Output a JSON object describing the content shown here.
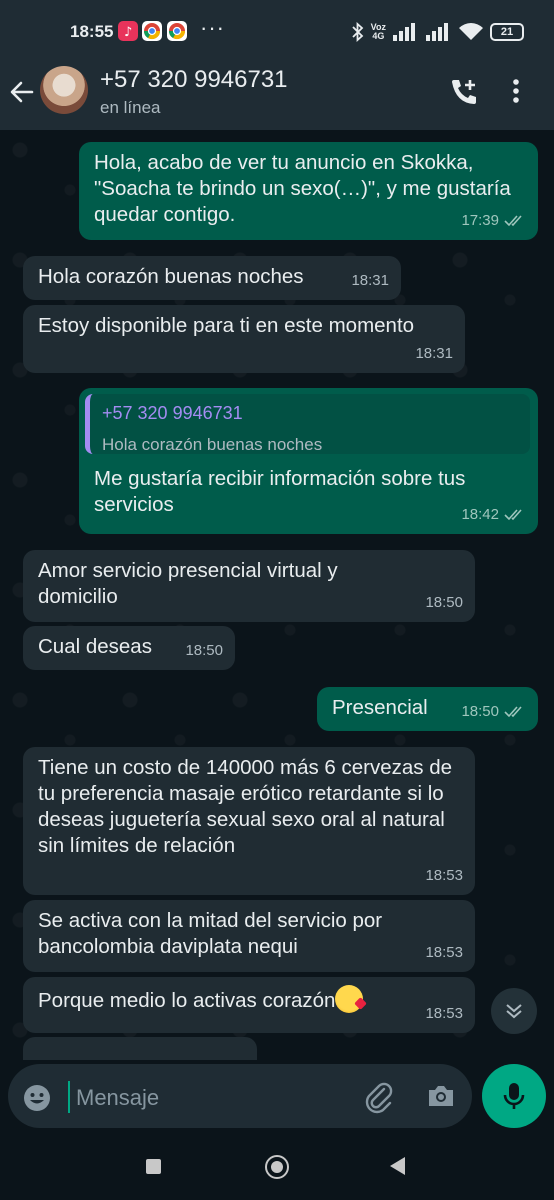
{
  "status_bar": {
    "time": "18:55",
    "network_label": "Voz\n4G",
    "battery": "21"
  },
  "header": {
    "contact_name": "+57 320 9946731",
    "status": "en línea"
  },
  "messages": [
    {
      "direction": "out",
      "text": "Hola, acabo de ver tu anuncio en Skokka, \"Soacha te brindo un sexo(…)\", y me gustaría quedar contigo.",
      "time": "17:39",
      "read": true
    },
    {
      "direction": "in",
      "text": "Hola corazón buenas noches",
      "time": "18:31"
    },
    {
      "direction": "in",
      "text": "Estoy disponible para ti en este momento",
      "time": "18:31"
    },
    {
      "direction": "out",
      "quote": {
        "name": "+57 320 9946731",
        "text": "Hola corazón buenas noches"
      },
      "text": "Me gustaría recibir información sobre tus servicios",
      "time": "18:42",
      "read": true
    },
    {
      "direction": "in",
      "text": "Amor servicio presencial virtual y domicilio",
      "time": "18:50"
    },
    {
      "direction": "in",
      "text": "Cual deseas",
      "time": "18:50"
    },
    {
      "direction": "out",
      "text": "Presencial",
      "time": "18:50",
      "read": true
    },
    {
      "direction": "in",
      "text": "Tiene un costo de 140000 más 6 cervezas de tu preferencia masaje erótico retardante si lo deseas juguetería sexual sexo oral al natural sin límites de relación",
      "time": "18:53"
    },
    {
      "direction": "in",
      "text": "Se activa con la mitad del servicio por bancolombia daviplata nequi",
      "time": "18:53"
    },
    {
      "direction": "in",
      "text": "Porque medio lo activas corazón",
      "emoji": "face-blowing-kiss",
      "time": "18:53"
    }
  ],
  "input": {
    "placeholder": "Mensaje"
  },
  "colors": {
    "background": "#0b141a",
    "header": "#1f2c34",
    "incoming_bubble": "#202c33",
    "outgoing_bubble": "#005c4b",
    "accent": "#00a884"
  }
}
